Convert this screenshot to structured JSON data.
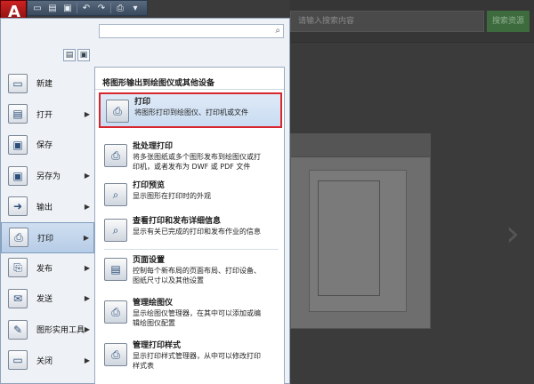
{
  "background": {
    "search_placeholder": "请输入搜索内容",
    "search_button": "搜索资源",
    "next_arrow": "›"
  },
  "app_menu": {
    "logo_glyph": "A",
    "qat_icons": [
      "new-icon",
      "open-icon",
      "save-icon",
      "undo-icon",
      "redo-icon",
      "plot-icon"
    ],
    "search_placeholder": "",
    "nav": [
      {
        "label": "新建",
        "icon": "new-drawing-icon",
        "glyph": "▭",
        "has_submenu": false,
        "active": false
      },
      {
        "label": "打开",
        "icon": "open-folder-icon",
        "glyph": "▤",
        "has_submenu": true,
        "active": false
      },
      {
        "label": "保存",
        "icon": "save-disk-icon",
        "glyph": "▣",
        "has_submenu": false,
        "active": false
      },
      {
        "label": "另存为",
        "icon": "save-as-icon",
        "glyph": "▣",
        "has_submenu": true,
        "active": false
      },
      {
        "label": "输出",
        "icon": "export-icon",
        "glyph": "➜",
        "has_submenu": true,
        "active": false
      },
      {
        "label": "打印",
        "icon": "printer-icon",
        "glyph": "⎙",
        "has_submenu": true,
        "active": true
      },
      {
        "label": "发布",
        "icon": "publish-icon",
        "glyph": "⎘",
        "has_submenu": true,
        "active": false
      },
      {
        "label": "发送",
        "icon": "send-icon",
        "glyph": "✉",
        "has_submenu": true,
        "active": false
      },
      {
        "label": "图形实用工具",
        "icon": "utilities-icon",
        "glyph": "✎",
        "has_submenu": true,
        "active": false
      },
      {
        "label": "关闭",
        "icon": "close-drawing-icon",
        "glyph": "▭",
        "has_submenu": true,
        "active": false
      }
    ],
    "panel": {
      "title": "将图形输出到绘图仪或其他设备",
      "entries": [
        {
          "title": "打印",
          "desc": [
            "将图形打印到绘图仪、打印机或文件"
          ],
          "icon": "printer-icon",
          "glyph": "⎙",
          "selected": true
        },
        {
          "title": "批处理打印",
          "desc": [
            "将多张图纸或多个图形发布到绘图仪或打",
            "印机，或者发布为 DWF 或 PDF 文件"
          ],
          "icon": "batch-plot-icon",
          "glyph": "⎙",
          "selected": false
        },
        {
          "title": "打印预览",
          "desc": [
            "显示图形在打印时的外观"
          ],
          "icon": "plot-preview-icon",
          "glyph": "⌕",
          "selected": false
        },
        {
          "title": "查看打印和发布详细信息",
          "desc": [
            "显示有关已完成的打印和发布作业的信息"
          ],
          "icon": "plot-details-icon",
          "glyph": "⌕",
          "selected": false
        },
        {
          "title": "页面设置",
          "desc": [
            "控制每个新布局的页面布局、打印设备、",
            "图纸尺寸以及其他设置"
          ],
          "icon": "page-setup-icon",
          "glyph": "▤",
          "selected": false
        },
        {
          "title": "管理绘图仪",
          "desc": [
            "显示绘图仪管理器，在其中可以添加或编",
            "辑绘图仪配置"
          ],
          "icon": "plotter-manager-icon",
          "glyph": "⎙",
          "selected": false
        },
        {
          "title": "管理打印样式",
          "desc": [
            "显示打印样式管理器，从中可以修改打印",
            "样式表"
          ],
          "icon": "plot-style-icon",
          "glyph": "⎙",
          "selected": false
        }
      ]
    }
  }
}
